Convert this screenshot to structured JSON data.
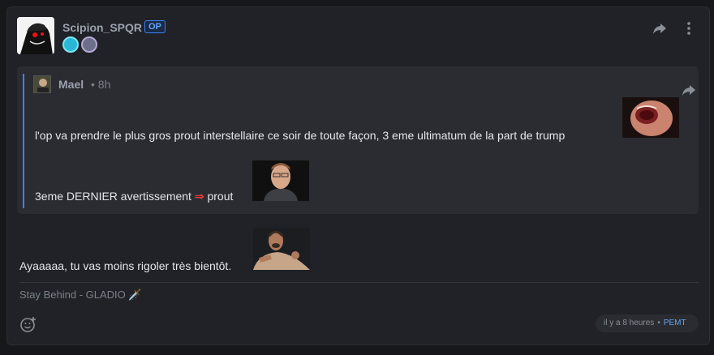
{
  "post": {
    "author": "Scipion_SPQR",
    "op_badge": "OP",
    "quote": {
      "author": "Mael",
      "time": "• 8h",
      "line1": "l'op va prendre le plus gros prout interstellaire ce soir de toute façon, 3 eme ultimatum de la part de trump",
      "line2_before": "3eme DERNIER avertissement",
      "line2_arrow": "⇒",
      "line2_after": "prout"
    },
    "reply_text": "Ayaaaaa, tu vas moins rigoler très bientôt.",
    "signature": "Stay Behind - GLADIO",
    "signature_emoji": "🗡️",
    "meta": {
      "time": "il y a 8 heures",
      "tag": "PEMT"
    }
  },
  "icons": {
    "share": "share-icon",
    "more": "more-vertical-icon",
    "react": "add-reaction-icon"
  },
  "colors": {
    "accent": "#3b82f6",
    "card_bg": "#202227",
    "quote_bg": "#2a2c31"
  }
}
